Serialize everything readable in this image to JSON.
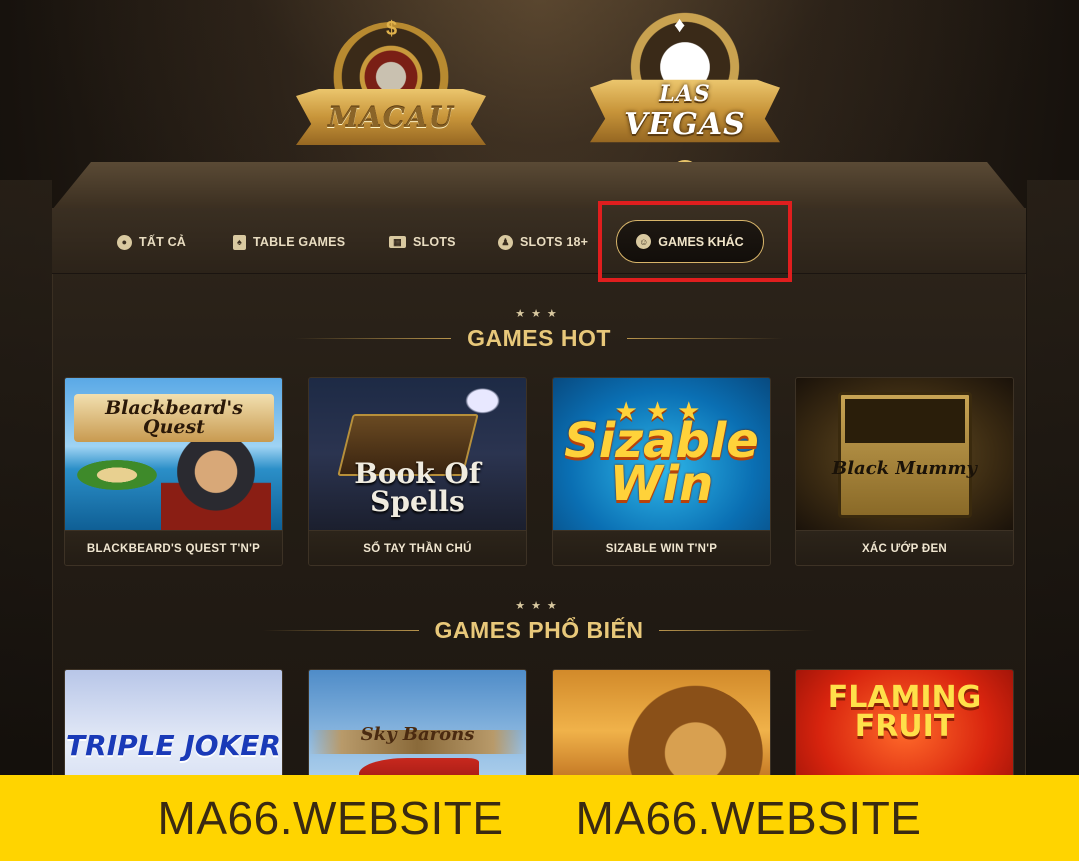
{
  "logos": {
    "macau": "MACAU",
    "vegas_line1": "LAS",
    "vegas_line2": "VEGAS"
  },
  "tabs": [
    {
      "label": "TẤT CẢ",
      "icon": "chip-icon"
    },
    {
      "label": "TABLE GAMES",
      "icon": "card-icon"
    },
    {
      "label": "SLOTS",
      "icon": "slot-machine-icon"
    },
    {
      "label": "SLOTS 18+",
      "icon": "person-icon"
    },
    {
      "label": "GAMES KHÁC",
      "icon": "smile-icon",
      "active": true
    }
  ],
  "sections": {
    "hot": {
      "title": "GAMES HOT",
      "games": [
        {
          "label": "BLACKBEARD'S QUEST T'N'P",
          "art_title": "Blackbeard's Quest"
        },
        {
          "label": "SỔ TAY THẦN CHÚ",
          "art_title": "Book Of Spells"
        },
        {
          "label": "SIZABLE WIN T'N'P",
          "art_title": "Sizable Win"
        },
        {
          "label": "XÁC ƯỚP ĐEN",
          "art_title": "Black Mummy"
        }
      ]
    },
    "popular": {
      "title": "GAMES PHỔ BIẾN",
      "games": [
        {
          "art_title": "TRIPLE JOKER"
        },
        {
          "art_title": "Sky Barons"
        },
        {
          "art_title": ""
        },
        {
          "art_title": "FLAMING FRUIT"
        }
      ]
    }
  },
  "watermark": {
    "left": "MA66.WEBSITE",
    "right": "MA66.WEBSITE"
  },
  "colors": {
    "accent_gold": "#e8c87a",
    "highlight_red": "#e01e1e",
    "watermark_bg": "#ffd400"
  }
}
